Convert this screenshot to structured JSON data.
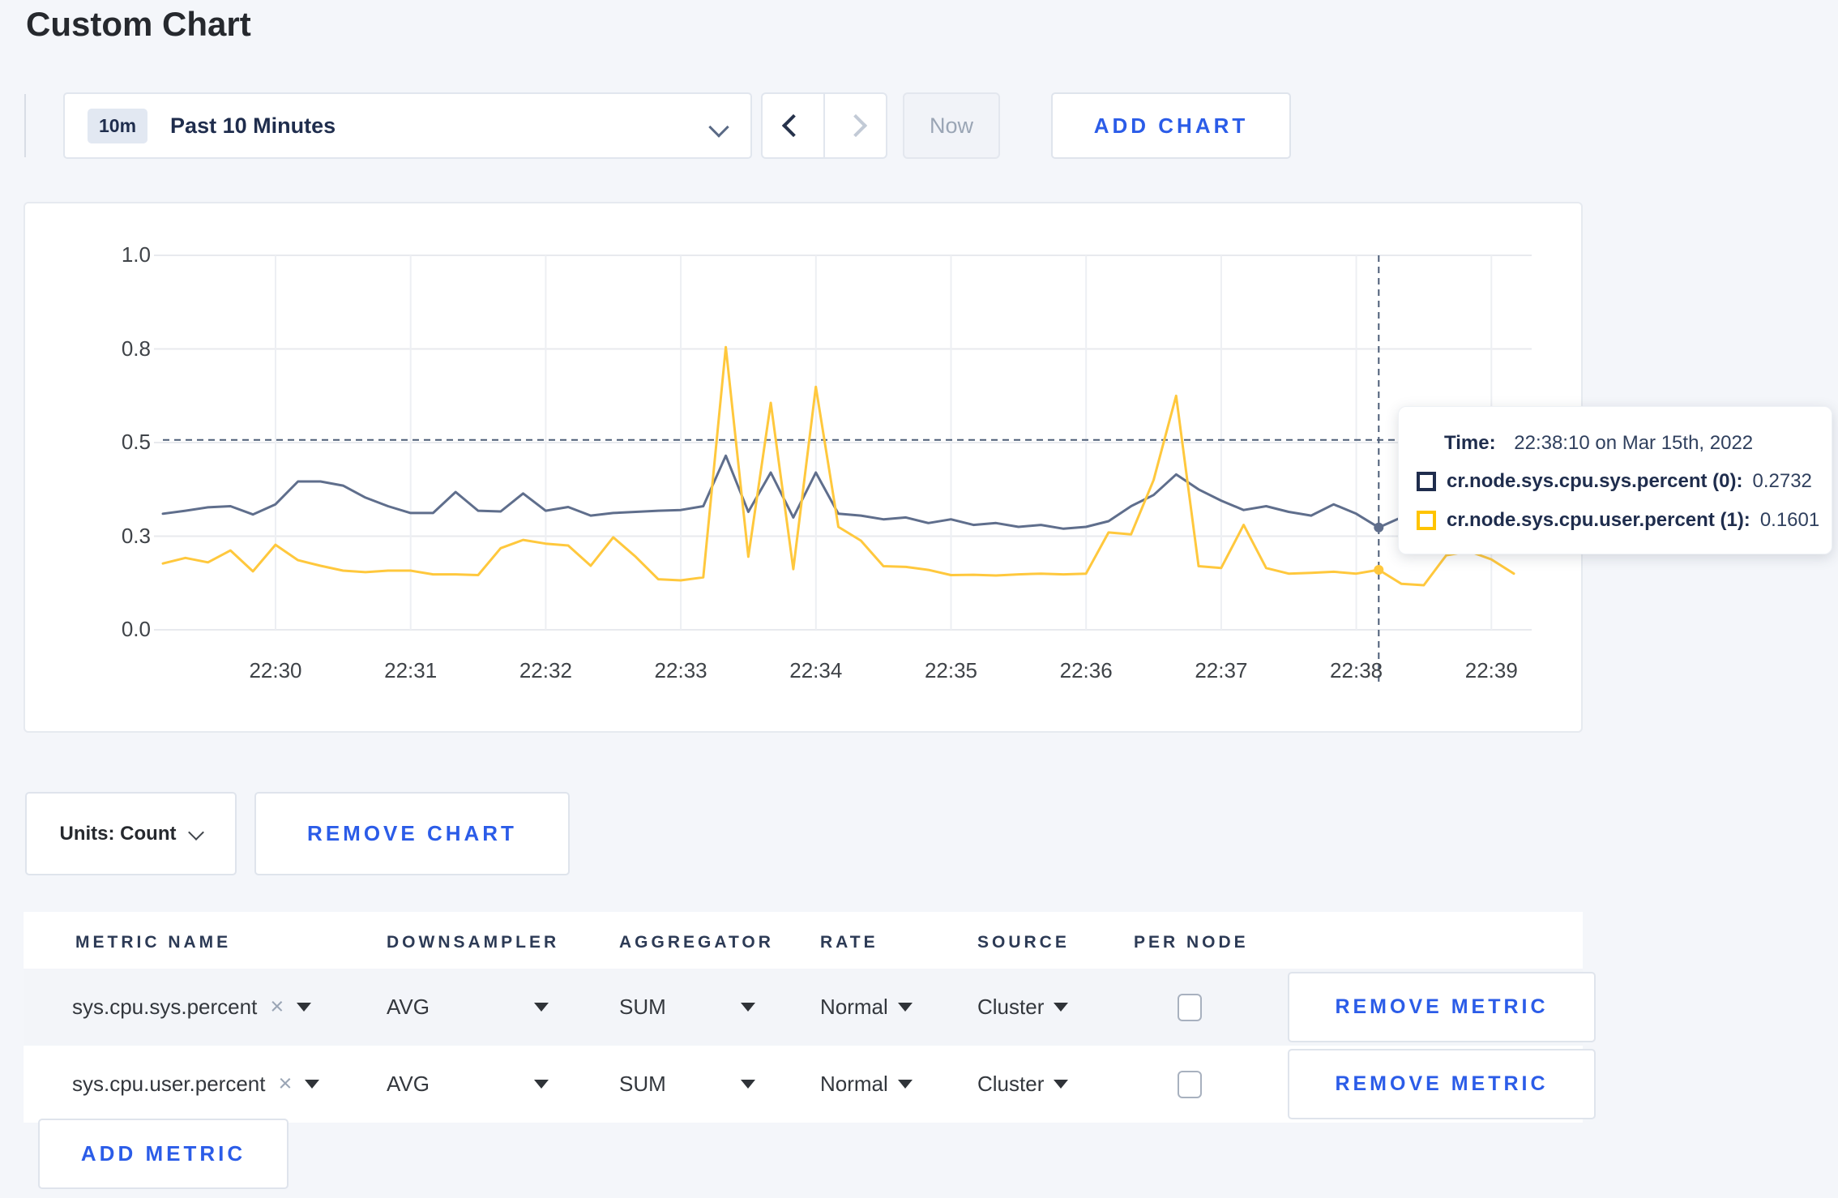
{
  "page_title": "Custom Chart",
  "toolbar": {
    "range_badge": "10m",
    "range_label": "Past 10 Minutes",
    "now_label": "Now",
    "add_chart_label": "ADD CHART"
  },
  "chart_controls": {
    "units_label": "Units: Count",
    "remove_chart_label": "REMOVE CHART"
  },
  "tooltip": {
    "time_label": "Time:",
    "time_value": "22:38:10 on Mar 15th, 2022",
    "rows": [
      {
        "label": "cr.node.sys.cpu.sys.percent (0):",
        "value": "0.2732",
        "color": "#1f2d4d"
      },
      {
        "label": "cr.node.sys.cpu.user.percent (1):",
        "value": "0.1601",
        "color": "#ffc400"
      }
    ]
  },
  "chart_data": {
    "type": "line",
    "x_ticks": [
      "22:30",
      "22:31",
      "22:32",
      "22:33",
      "22:34",
      "22:35",
      "22:36",
      "22:37",
      "22:38",
      "22:39"
    ],
    "y_ticks": [
      {
        "label": "0.0",
        "value": 0
      },
      {
        "label": "0.3",
        "value": 0.25
      },
      {
        "label": "0.5",
        "value": 0.5
      },
      {
        "label": "0.8",
        "value": 0.75
      },
      {
        "label": "1.0",
        "value": 1
      }
    ],
    "y_domain": [
      0,
      1
    ],
    "start_time": "22:29:10",
    "interval_seconds": 10,
    "grid": true,
    "series": [
      {
        "name": "cr.node.sys.cpu.sys.percent",
        "color": "#5f6e8c",
        "values": [
          0.31,
          0.318,
          0.327,
          0.33,
          0.308,
          0.335,
          0.396,
          0.396,
          0.385,
          0.353,
          0.33,
          0.312,
          0.312,
          0.368,
          0.318,
          0.316,
          0.364,
          0.318,
          0.328,
          0.305,
          0.312,
          0.315,
          0.318,
          0.32,
          0.33,
          0.465,
          0.315,
          0.42,
          0.3,
          0.42,
          0.31,
          0.305,
          0.295,
          0.3,
          0.285,
          0.295,
          0.28,
          0.285,
          0.275,
          0.28,
          0.27,
          0.275,
          0.29,
          0.33,
          0.36,
          0.415,
          0.375,
          0.345,
          0.32,
          0.33,
          0.315,
          0.305,
          0.335,
          0.31,
          0.2732,
          0.3,
          0.31,
          0.305,
          0.295,
          0.3,
          0.295
        ]
      },
      {
        "name": "cr.node.sys.cpu.user.percent",
        "color": "#ffc83d",
        "values": [
          0.177,
          0.192,
          0.18,
          0.212,
          0.156,
          0.227,
          0.186,
          0.171,
          0.158,
          0.154,
          0.158,
          0.158,
          0.148,
          0.148,
          0.146,
          0.218,
          0.24,
          0.23,
          0.225,
          0.171,
          0.247,
          0.195,
          0.135,
          0.132,
          0.14,
          0.755,
          0.195,
          0.606,
          0.162,
          0.649,
          0.275,
          0.238,
          0.17,
          0.168,
          0.16,
          0.146,
          0.147,
          0.145,
          0.148,
          0.15,
          0.148,
          0.15,
          0.26,
          0.255,
          0.4,
          0.625,
          0.17,
          0.165,
          0.28,
          0.165,
          0.15,
          0.152,
          0.155,
          0.15,
          0.1601,
          0.123,
          0.119,
          0.199,
          0.21,
          0.188,
          0.15
        ]
      }
    ],
    "crosshair": {
      "time": "22:38:10",
      "index": 54,
      "hline_value": 0.507
    }
  },
  "metrics_table": {
    "headers": [
      "METRIC NAME",
      "DOWNSAMPLER",
      "AGGREGATOR",
      "RATE",
      "SOURCE",
      "PER NODE"
    ],
    "rows": [
      {
        "metric": "sys.cpu.sys.percent",
        "downsampler": "AVG",
        "aggregator": "SUM",
        "rate": "Normal",
        "source": "Cluster",
        "per_node": false
      },
      {
        "metric": "sys.cpu.user.percent",
        "downsampler": "AVG",
        "aggregator": "SUM",
        "rate": "Normal",
        "source": "Cluster",
        "per_node": false
      }
    ],
    "remove_metric_label": "REMOVE METRIC",
    "add_metric_label": "ADD METRIC"
  },
  "colors": {
    "accent_blue": "#2b5ce8",
    "page_background": "#f4f6fa",
    "navy_text": "#1f2d4d",
    "gridline": "#e8eaee",
    "crosshair": "#4c5d77"
  }
}
